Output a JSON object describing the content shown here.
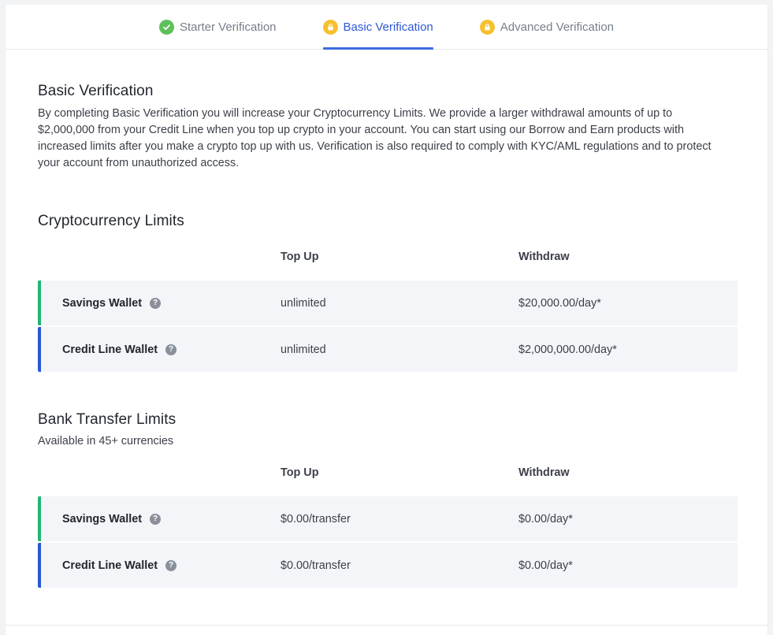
{
  "tabs": [
    {
      "label": "Starter Verification",
      "icon": "check-circle-icon",
      "active": false
    },
    {
      "label": "Basic Verification",
      "icon": "lock-icon",
      "active": true
    },
    {
      "label": "Advanced Verification",
      "icon": "lock-icon",
      "active": false
    }
  ],
  "basic": {
    "title": "Basic Verification",
    "description": "By completing Basic Verification you will increase your Cryptocurrency Limits. We provide a larger withdrawal amounts of up to $2,000,000 from your Credit Line when you top up crypto in your account. You can start using our Borrow and Earn products with increased limits after you make a crypto top up with us. Verification is also required to comply with KYC/AML regulations and to protect your account from unauthorized access."
  },
  "crypto_limits": {
    "title": "Cryptocurrency Limits",
    "header": {
      "top_up": "Top Up",
      "withdraw": "Withdraw"
    },
    "rows": [
      {
        "wallet": "Savings Wallet",
        "top_up": "unlimited",
        "withdraw": "$20,000.00/day*"
      },
      {
        "wallet": "Credit Line Wallet",
        "top_up": "unlimited",
        "withdraw": "$2,000,000.00/day*"
      }
    ]
  },
  "bank_limits": {
    "title": "Bank Transfer Limits",
    "subtitle": "Available in 45+ currencies",
    "header": {
      "top_up": "Top Up",
      "withdraw": "Withdraw"
    },
    "rows": [
      {
        "wallet": "Savings Wallet",
        "top_up": "$0.00/transfer",
        "withdraw": "$0.00/day*"
      },
      {
        "wallet": "Credit Line Wallet",
        "top_up": "$0.00/transfer",
        "withdraw": "$0.00/day*"
      }
    ]
  },
  "help_icon_glyph": "?",
  "colors": {
    "accent": "#2e58d6",
    "savings_bar": "#22b573",
    "credit_bar": "#2856d4",
    "check": "#5fc05a",
    "lock": "#f6c12f"
  }
}
